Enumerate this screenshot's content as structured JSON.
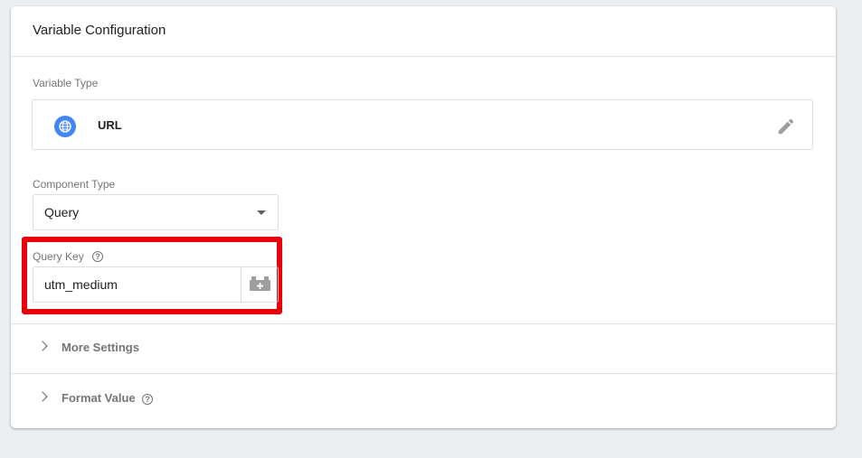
{
  "card": {
    "title": "Variable Configuration"
  },
  "variable_type": {
    "label": "Variable Type",
    "name": "URL",
    "icon": "globe-icon",
    "edit_icon": "pencil-icon"
  },
  "component_type": {
    "label": "Component Type",
    "selected": "Query"
  },
  "query_key": {
    "label": "Query Key",
    "value": "utm_medium",
    "help_icon": "help-circle-icon",
    "picker_icon": "variable-picker-icon"
  },
  "sections": [
    {
      "label": "More Settings"
    },
    {
      "label": "Format Value"
    }
  ],
  "colors": {
    "accent": "#4285f4",
    "highlight": "#e8000b"
  }
}
